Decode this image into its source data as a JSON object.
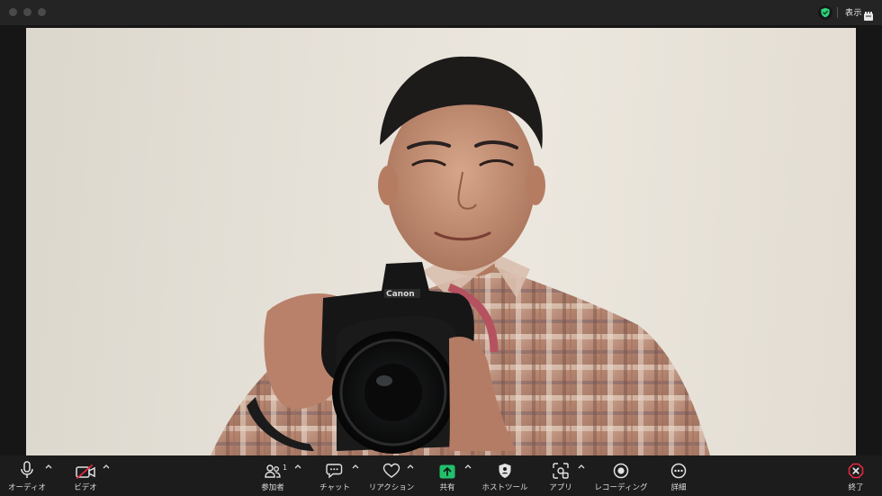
{
  "window": {
    "view_label": "表示",
    "icons": {
      "security": "shield-check-icon",
      "view": "grid-view-icon"
    },
    "colors": {
      "security_green": "#2fd17a"
    }
  },
  "video": {
    "participant_count": "1"
  },
  "toolbar": {
    "audio": {
      "label": "オーディオ",
      "icon": "microphone-icon"
    },
    "video": {
      "label": "ビデオ",
      "icon": "video-camera-off-icon",
      "state": "off"
    },
    "participants": {
      "label": "参加者",
      "icon": "participants-icon",
      "count": "1"
    },
    "chat": {
      "label": "チャット",
      "icon": "chat-icon"
    },
    "reactions": {
      "label": "リアクション",
      "icon": "heart-icon"
    },
    "share": {
      "label": "共有",
      "icon": "share-screen-icon"
    },
    "host_tools": {
      "label": "ホストツール",
      "icon": "host-shield-icon"
    },
    "apps": {
      "label": "アプリ",
      "icon": "apps-icon"
    },
    "recording": {
      "label": "レコーディング",
      "icon": "record-icon"
    },
    "more": {
      "label": "詳細",
      "icon": "more-icon"
    },
    "end": {
      "label": "終了",
      "icon": "end-call-icon"
    },
    "colors": {
      "share_green": "#21c06b",
      "end_red": "#e0293f",
      "video_off_red": "#e0293f"
    }
  }
}
